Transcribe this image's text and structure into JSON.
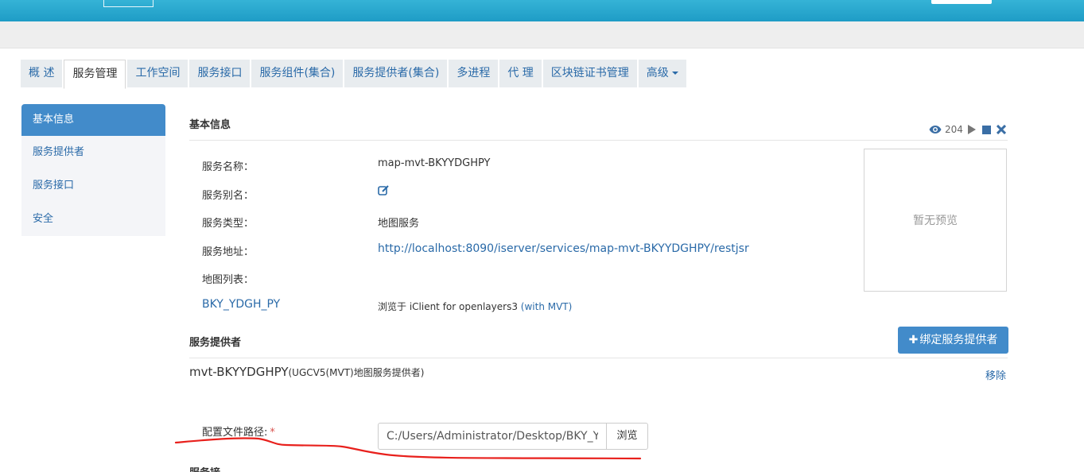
{
  "tabs": [
    {
      "label": "概 述"
    },
    {
      "label": "服务管理"
    },
    {
      "label": "工作空间"
    },
    {
      "label": "服务接口"
    },
    {
      "label": "服务组件(集合)"
    },
    {
      "label": "服务提供者(集合)"
    },
    {
      "label": "多进程"
    },
    {
      "label": "代 理"
    },
    {
      "label": "区块链证书管理"
    },
    {
      "label": "高级"
    }
  ],
  "sidebar": {
    "items": [
      {
        "label": "基本信息"
      },
      {
        "label": "服务提供者"
      },
      {
        "label": "服务接口"
      },
      {
        "label": "安全"
      }
    ]
  },
  "basic_info": {
    "title": "基本信息",
    "view_count": "204",
    "icons": [
      "eye-icon",
      "play-icon",
      "stop-icon",
      "close-icon"
    ],
    "labels": {
      "name": "服务名称：",
      "alias": "服务别名：",
      "type": "服务类型：",
      "address": "服务地址：",
      "map_list": "地图列表："
    },
    "values": {
      "name": "map-mvt-BKYYDGHPY",
      "type": "地图服务",
      "address": "http://localhost:8090/iserver/services/map-mvt-BKYYDGHPY/restjsr"
    },
    "map_item": {
      "name": "BKY_YDGH_PY",
      "browse_prefix": "浏览于 iClient for openlayers3 ",
      "browse_link": "(with MVT)"
    },
    "preview_text": "暂无预览"
  },
  "provider": {
    "title": "服务提供者",
    "bind_button": "绑定服务提供者",
    "name": "mvt-BKYYDGHPY",
    "type": "(UGCV5(MVT)地图服务提供者)",
    "remove": "移除"
  },
  "config": {
    "label": "配置文件路径:",
    "required_mark": "*",
    "path_value": "C:/Users/Administrator/Desktop/BKY_YDGH_PY",
    "browse_button": "浏览"
  },
  "colors": {
    "topbar": "#2aa9d2",
    "primary": "#428bca",
    "link": "#2a6aa8",
    "annotation": "#e8201c"
  }
}
